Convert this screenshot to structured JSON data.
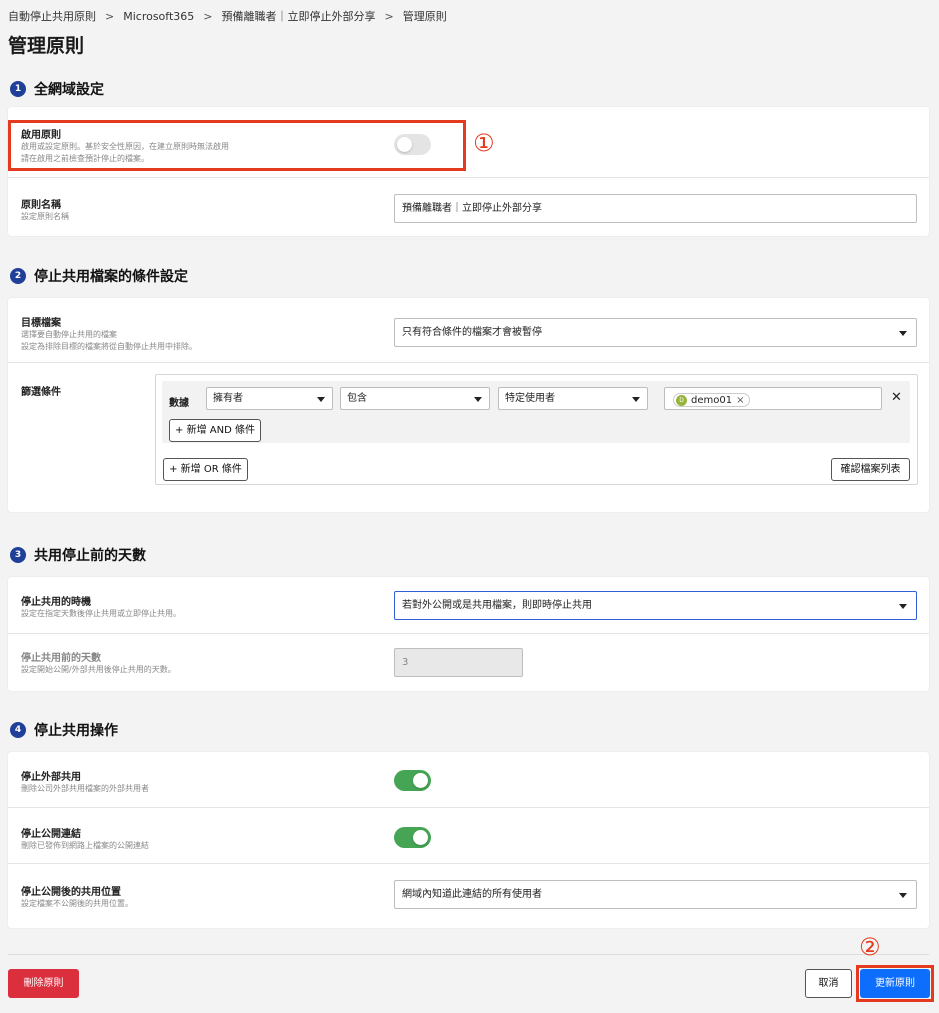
{
  "breadcrumb": [
    "自動停止共用原則",
    "Microsoft365",
    "預備離職者｜立即停止外部分享",
    "管理原則"
  ],
  "page_title": "管理原則",
  "sections": {
    "s1": {
      "num": "1",
      "title": "全網域設定"
    },
    "s2": {
      "num": "2",
      "title": "停止共用檔案的條件設定"
    },
    "s3": {
      "num": "3",
      "title": "共用停止前的天數"
    },
    "s4": {
      "num": "4",
      "title": "停止共用操作"
    }
  },
  "enable_policy": {
    "label": "啟用原則",
    "desc1": "啟用或設定原則。基於安全性原因，在建立原則時無法啟用",
    "desc2": "請在啟用之前檢查預計停止的檔案。",
    "state": "off"
  },
  "policy_name": {
    "label": "原則名稱",
    "desc": "設定原則名稱",
    "value": "預備離職者｜立即停止外部分享"
  },
  "target_files": {
    "label": "目標檔案",
    "desc1": "選擇要自動停止共用的檔案",
    "desc2": "設定為排除目標的檔案將從自動停止共用中排除。",
    "value": "只有符合條件的檔案才會被暫停"
  },
  "filter": {
    "label": "篩選條件",
    "row_label": "數據",
    "field": "擁有者",
    "operator": "包含",
    "value_type": "特定使用者",
    "chip_avatar": "D",
    "chip_text": "demo01",
    "chip_remove": "×",
    "remove_row": "✕",
    "add_and": "+ 新增 AND 條件",
    "add_or": "+ 新增 OR 條件",
    "check_files": "確認檔案列表"
  },
  "stop_timing": {
    "label": "停止共用的時機",
    "desc": "設定在指定天數後停止共用或立即停止共用。",
    "value": "若對外公開或是共用檔案，則即時停止共用"
  },
  "days_before": {
    "label": "停止共用前的天數",
    "desc": "設定開始公開/外部共用後停止共用的天數。",
    "value": "3"
  },
  "stop_external": {
    "label": "停止外部共用",
    "desc": "刪除公司外部共用檔案的外部共用者",
    "state": "on"
  },
  "stop_public_link": {
    "label": "停止公開連結",
    "desc": "刪除已發佈到網路上檔案的公開連結",
    "state": "on"
  },
  "share_location": {
    "label": "停止公開後的共用位置",
    "desc": "設定檔案不公開後的共用位置。",
    "value": "網域內知道此連結的所有使用者"
  },
  "footer": {
    "delete": "刪除原則",
    "cancel": "取消",
    "update": "更新原則"
  },
  "annotations": {
    "marker1": "①",
    "marker2": "②"
  },
  "colors": {
    "primary": "#0d6efd",
    "danger": "#dc2f3e",
    "toggle_on": "#46a554",
    "section_badge": "#1f3f99",
    "annotation": "#e43a1f"
  }
}
